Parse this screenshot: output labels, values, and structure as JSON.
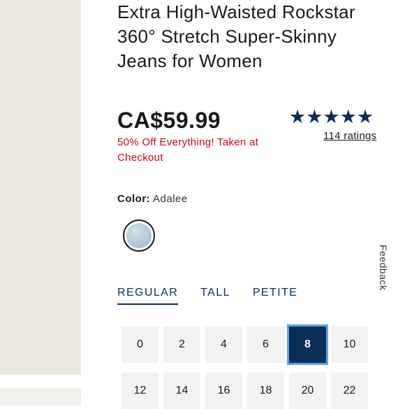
{
  "product": {
    "title": "Extra High-Waisted Rockstar 360° Stretch Super-Skinny Jeans for Women",
    "price": "CA$59.99",
    "promo": "50% Off Everything! Taken at Checkout",
    "rating": {
      "stars": "★★★★★",
      "value": 5,
      "count_label": "114 ratings"
    }
  },
  "color": {
    "label": "Color:",
    "value": "Adalee"
  },
  "feedback_label": "Feedback",
  "fit_tabs": [
    {
      "label": "REGULAR",
      "active": true
    },
    {
      "label": "TALL",
      "active": false
    },
    {
      "label": "PETITE",
      "active": false
    }
  ],
  "sizes": {
    "row1": [
      "0",
      "2",
      "4",
      "6",
      "8",
      "10"
    ],
    "row2": [
      "12",
      "14",
      "16",
      "18",
      "20",
      "22"
    ],
    "selected": "8"
  },
  "colors": {
    "navy": "#0b2e58",
    "promo_red": "#d0021b",
    "focus_ring": "#5aa3ef"
  }
}
